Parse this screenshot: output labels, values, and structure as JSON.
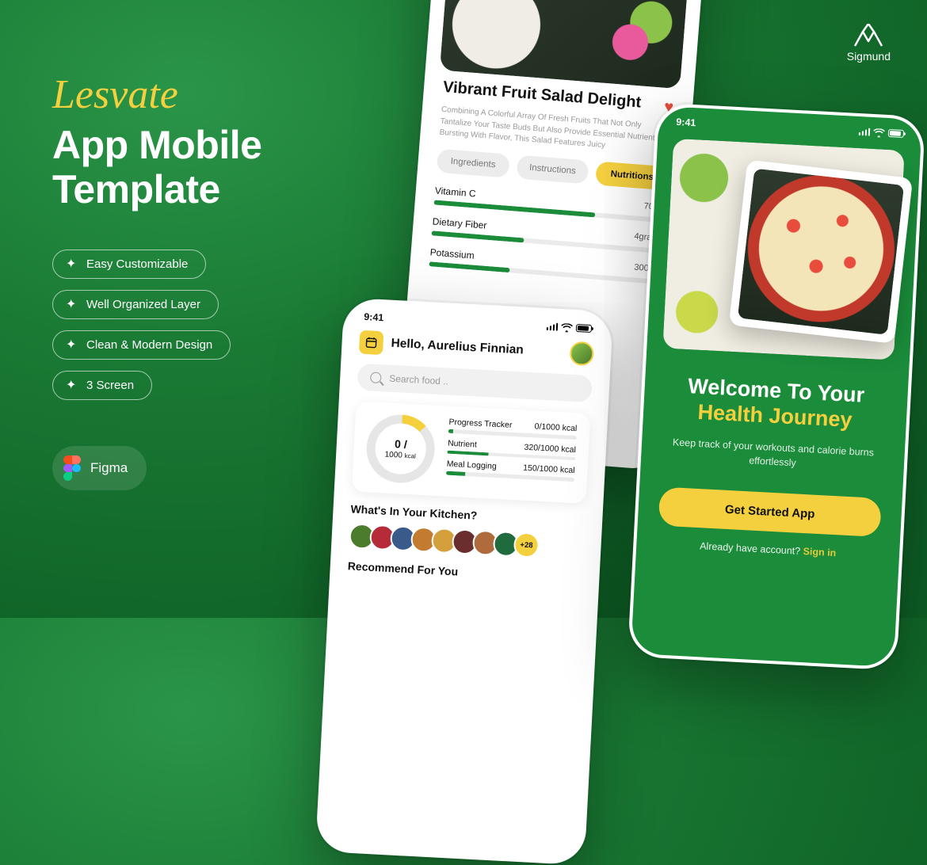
{
  "promo": {
    "brand": "Lesvate",
    "headline_l1": "App Mobile",
    "headline_l2": "Template",
    "features": [
      "Easy Customizable",
      "Well Organized Layer",
      "Clean & Modern Design",
      "3 Screen"
    ],
    "tool_label": "Figma"
  },
  "corp_brand": "Sigmund",
  "status_time": "9:41",
  "screen_a": {
    "title": "Vibrant Fruit Salad Delight",
    "description": "Combining A Colorful Array Of Fresh Fruits That Not Only Tantalize Your Taste Buds But Also Provide Essential Nutrients. Bursting With Flavor, This Salad Features Juicy",
    "tabs": {
      "ingredients": "Ingredients",
      "instructions": "Instructions",
      "nutritions": "Nutritions"
    },
    "nutrients": [
      {
        "label": "Vitamin C",
        "value": "70mg",
        "pct": 70
      },
      {
        "label": "Dietary Fiber",
        "value": "4grams",
        "pct": 40
      },
      {
        "label": "Potassium",
        "value": "300mg",
        "pct": 35
      }
    ]
  },
  "screen_b": {
    "greeting": "Hello, Aurelius Finnian",
    "search_placeholder": "Search food ..",
    "ring": {
      "current": "0 /",
      "total": "1000",
      "unit": "kcal"
    },
    "trackers": [
      {
        "label": "Progress Tracker",
        "value": "0/1000 kcal",
        "pct": 4
      },
      {
        "label": "Nutrient",
        "value": "320/1000 kcal",
        "pct": 32
      },
      {
        "label": "Meal Logging",
        "value": "150/1000 kcal",
        "pct": 15
      }
    ],
    "section_kitchen": "What's In Your Kitchen?",
    "section_recommend": "Recommend For You",
    "chip_count": 8,
    "more_label": "+28",
    "chip_colors": [
      "#4a7c2c",
      "#b52b3a",
      "#3a5a8c",
      "#c27b2f",
      "#d4a03c",
      "#6b2e2e",
      "#b06b3d",
      "#1f6b3d"
    ]
  },
  "screen_c": {
    "welcome_l1": "Welcome To Your",
    "welcome_l2": "Health Journey",
    "subtitle": "Keep track of your workouts and calorie burns effortlessly",
    "cta": "Get Started App",
    "have_account": "Already have account? ",
    "signin": "Sign in"
  }
}
